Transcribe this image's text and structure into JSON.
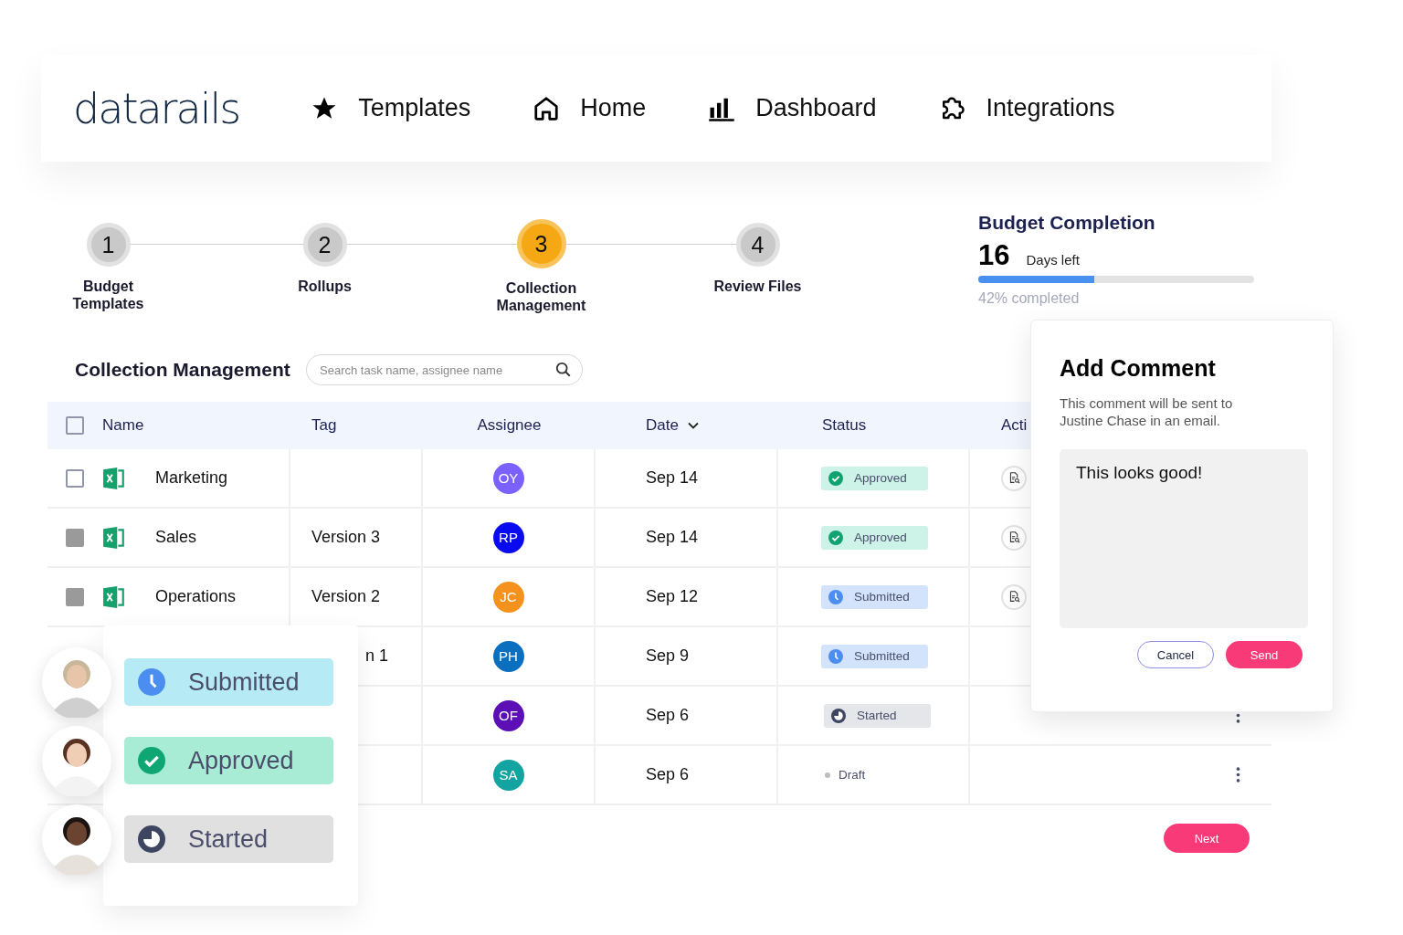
{
  "logo": "datarails",
  "nav": [
    {
      "label": "Templates",
      "kind": "star"
    },
    {
      "label": "Home",
      "kind": "home"
    },
    {
      "label": "Dashboard",
      "kind": "chart"
    },
    {
      "label": "Integrations",
      "kind": "puzzle"
    }
  ],
  "steps": [
    {
      "number": "1",
      "label": "Budget Templates",
      "selected": false
    },
    {
      "number": "2",
      "label": "Rollups",
      "selected": false
    },
    {
      "number": "3",
      "label": "Collection Management",
      "selected": true
    },
    {
      "number": "4",
      "label": "Review Files",
      "selected": false
    }
  ],
  "budget": {
    "title": "Budget Completion",
    "days": "16",
    "days_label": "Days left",
    "level": 0.42,
    "progress_text": "42% completed"
  },
  "section": {
    "title": "Collection Management",
    "search_placeholder": "Search task name, assignee name"
  },
  "table": {
    "header_checked": false,
    "columns": [
      {
        "label": "Name",
        "sorted": false
      },
      {
        "label": "Tag",
        "sorted": false
      },
      {
        "label": "Assignee",
        "sorted": false
      },
      {
        "label": "Date",
        "sorted": true
      },
      {
        "label": "Status",
        "sorted": false
      },
      {
        "label": "Acti",
        "sorted": false
      }
    ],
    "rows": [
      {
        "covered": false,
        "checked": false,
        "name": "Marketing",
        "tag": "",
        "assignee": "OY",
        "color": "#7b61ff",
        "date": "Sep 14",
        "status": {
          "label": "Approved",
          "kind": "approved"
        },
        "actions": [
          {
            "kind": "preview"
          }
        ]
      },
      {
        "covered": false,
        "checked": true,
        "name": "Sales",
        "tag": "Version 3",
        "assignee": "RP",
        "color": "#0a0af0",
        "date": "Sep 14",
        "status": {
          "label": "Approved",
          "kind": "approved"
        },
        "actions": [
          {
            "kind": "preview"
          }
        ]
      },
      {
        "covered": false,
        "checked": true,
        "name": "Operations",
        "tag": "Version 2",
        "assignee": "JC",
        "color": "#f5921e",
        "date": "Sep 12",
        "status": {
          "label": "Submitted",
          "kind": "submitted"
        },
        "actions": [
          {
            "kind": "preview"
          }
        ]
      },
      {
        "covered": true,
        "tag": "n 1",
        "assignee": "PH",
        "color": "#0b6fc0",
        "date": "Sep 9",
        "status": {
          "label": "Submitted",
          "kind": "submitted"
        }
      },
      {
        "assignee": "OF",
        "color": "#5b0fb5",
        "date": "Sep 6",
        "status": {
          "label": "Started",
          "kind": "started"
        },
        "actions": [
          {
            "kind": "menu"
          }
        ]
      },
      {
        "assignee": "SA",
        "color": "#13a3a0",
        "date": "Sep 6",
        "status": {
          "label": "Draft",
          "kind": "draft"
        },
        "actions": [
          {
            "kind": "menu"
          }
        ]
      }
    ]
  },
  "floating_statuses": [
    {
      "label": "Submitted",
      "kind": "submitted"
    },
    {
      "label": "Approved",
      "kind": "approved"
    },
    {
      "label": "Started",
      "kind": "started"
    }
  ],
  "comment_dialog": {
    "title": "Add Comment",
    "description": "This comment will be sent to Justine Chase in an email.",
    "value": "This looks good!",
    "buttons": [
      "Cancel",
      "Send"
    ]
  },
  "next_button": "Next"
}
